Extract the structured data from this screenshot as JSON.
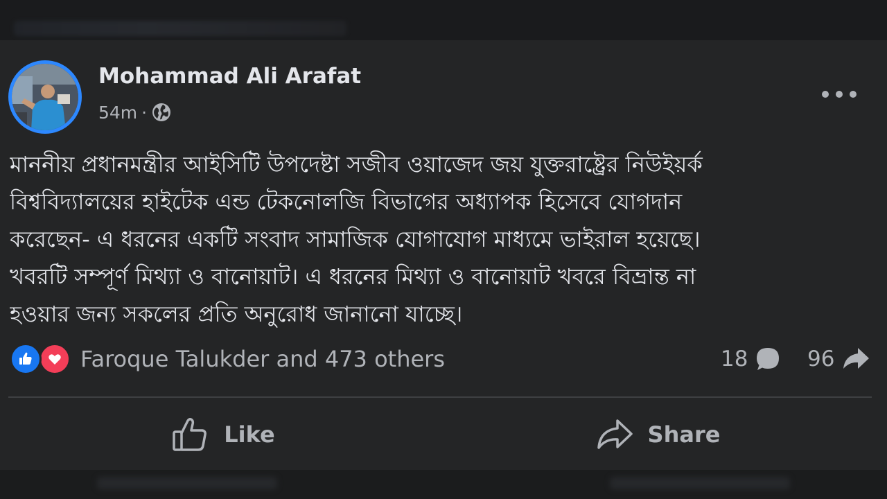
{
  "post": {
    "author": "Mohammad Ali Arafat",
    "time": "54m",
    "separator": "·",
    "privacy_icon": "globe-icon",
    "more_icon": "more-options-icon",
    "text_lines": [
      "মাননীয় প্রধানমন্ত্রীর আইসিটি উপদেষ্টা সজীব ওয়াজেদ জয় যুক্তরাষ্ট্রের নিউইয়র্ক",
      "বিশ্ববিদ্যালয়ের হাইটেক এন্ড টেকনোলজি বিভাগের অধ্যাপক হিসেবে যোগদান",
      "করেছেন- এ ধরনের একটি সংবাদ সামাজিক যোগাযোগ মাধ্যমে ভাইরাল হয়েছে।",
      "খবরটি সম্পূর্ণ মিথ্যা ও বানোয়াট। এ ধরনের মিথ্যা ও বানোয়াট খবরে বিভ্রান্ত না",
      "হওয়ার জন্য সকলের প্রতি অনুরোধ জানানো যাচ্ছে।"
    ]
  },
  "reactions": {
    "icons": [
      "like-reaction-icon",
      "love-reaction-icon"
    ],
    "text": "Faroque Talukder and 473 others",
    "comments_count": "18",
    "shares_count": "96"
  },
  "actions": {
    "like_label": "Like",
    "share_label": "Share"
  },
  "colors": {
    "background": "#242526",
    "text": "#e4e6eb",
    "secondary_text": "#b0b3b8",
    "like_blue": "#1877f2",
    "love_red": "#f33e58",
    "avatar_ring": "#2d88ff"
  }
}
